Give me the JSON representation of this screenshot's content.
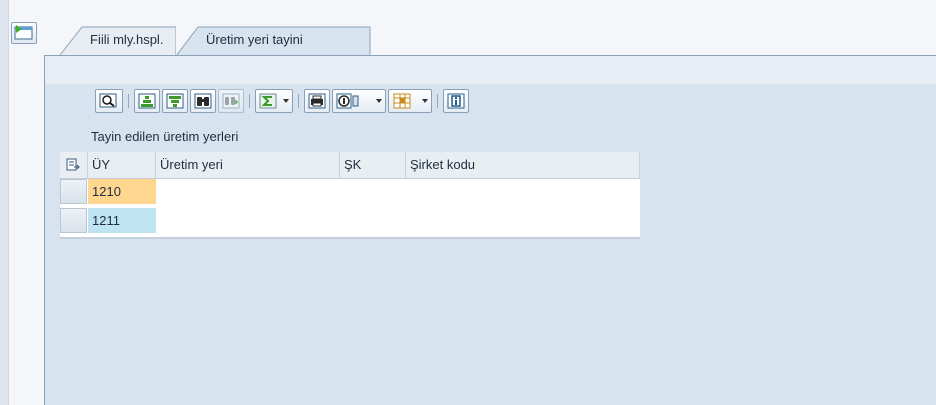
{
  "tabs": [
    {
      "label": "Fiili mly.hspl.",
      "active": false
    },
    {
      "label": "Üretim yeri tayini",
      "active": true
    }
  ],
  "toolbar": {
    "buttons": [
      {
        "icon": "details-icon"
      },
      {
        "icon": "sort-ascending-icon"
      },
      {
        "icon": "sort-descending-icon"
      },
      {
        "icon": "find-icon"
      },
      {
        "icon": "find-next-icon",
        "disabled": true
      },
      {
        "icon": "sum-icon",
        "dropdown": true
      },
      {
        "icon": "print-icon"
      },
      {
        "icon": "views-icon",
        "dropdown": true
      },
      {
        "icon": "layout-icon",
        "dropdown": true
      },
      {
        "icon": "info-icon"
      }
    ]
  },
  "grid": {
    "title": "Tayin edilen üretim yerleri",
    "columns": [
      "ÜY",
      "Üretim yeri",
      "ŞK",
      "Şirket kodu"
    ],
    "rows": [
      {
        "uy": "1210",
        "uretim_yeri": "",
        "sk": "",
        "sirket_kodu": "",
        "highlight": "#ffd68f"
      },
      {
        "uy": "1211",
        "uretim_yeri": "",
        "sk": "",
        "sirket_kodu": "",
        "highlight": "#bfe3f0"
      }
    ]
  }
}
